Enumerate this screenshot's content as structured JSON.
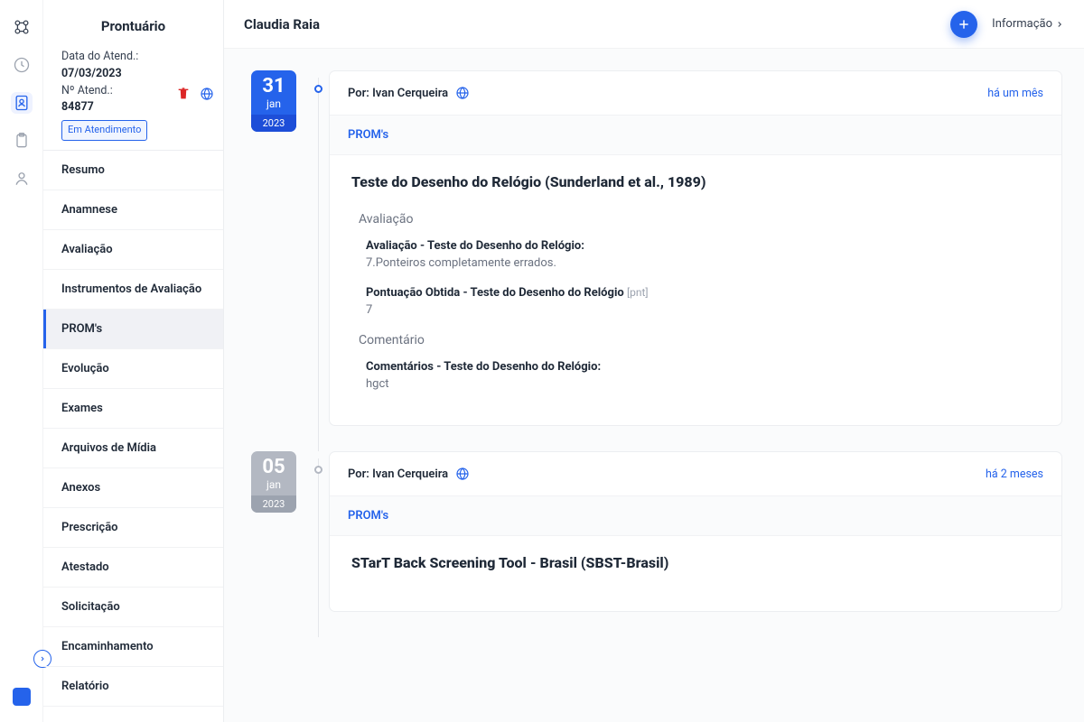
{
  "sidebar": {
    "title": "Prontuário",
    "info": {
      "date_label": "Data do Atend.:",
      "date_value": "07/03/2023",
      "num_label": "Nº Atend.:",
      "num_value": "84877",
      "status": "Em Atendimento"
    },
    "nav": [
      {
        "label": "Resumo"
      },
      {
        "label": "Anamnese"
      },
      {
        "label": "Avaliação"
      },
      {
        "label": "Instrumentos de Avaliação"
      },
      {
        "label": "PROM's",
        "active": true
      },
      {
        "label": "Evolução"
      },
      {
        "label": "Exames"
      },
      {
        "label": "Arquivos de Mídia"
      },
      {
        "label": "Anexos"
      },
      {
        "label": "Prescrição"
      },
      {
        "label": "Atestado"
      },
      {
        "label": "Solicitação"
      },
      {
        "label": "Encaminhamento"
      },
      {
        "label": "Relatório"
      }
    ]
  },
  "topbar": {
    "patient_name": "Claudia Raia",
    "info_label": "Informação"
  },
  "timeline": [
    {
      "date": {
        "day": "31",
        "month": "jan",
        "year": "2023",
        "active": true
      },
      "author_prefix": "Por: ",
      "author": "Ivan Cerqueira",
      "time_ago": "há um mês",
      "tab": "PROM's",
      "title": "Teste do Desenho do Relógio (Sunderland et al., 1989)",
      "sections": [
        {
          "heading": "Avaliação",
          "fields": [
            {
              "label": "Avaliação - Teste do Desenho do Relógio:",
              "value": "7.Ponteiros completamente errados."
            },
            {
              "label": "Pontuação Obtida - Teste do Desenho do Relógio",
              "unit": "[pnt]",
              "value": "7"
            }
          ]
        },
        {
          "heading": "Comentário",
          "fields": [
            {
              "label": "Comentários - Teste do Desenho do Relógio:",
              "value": "hgct"
            }
          ]
        }
      ]
    },
    {
      "date": {
        "day": "05",
        "month": "jan",
        "year": "2023",
        "active": false
      },
      "author_prefix": "Por: ",
      "author": "Ivan Cerqueira",
      "time_ago": "há 2 meses",
      "tab": "PROM's",
      "title": "STarT Back Screening Tool - Brasil (SBST-Brasil)",
      "sections": []
    }
  ]
}
